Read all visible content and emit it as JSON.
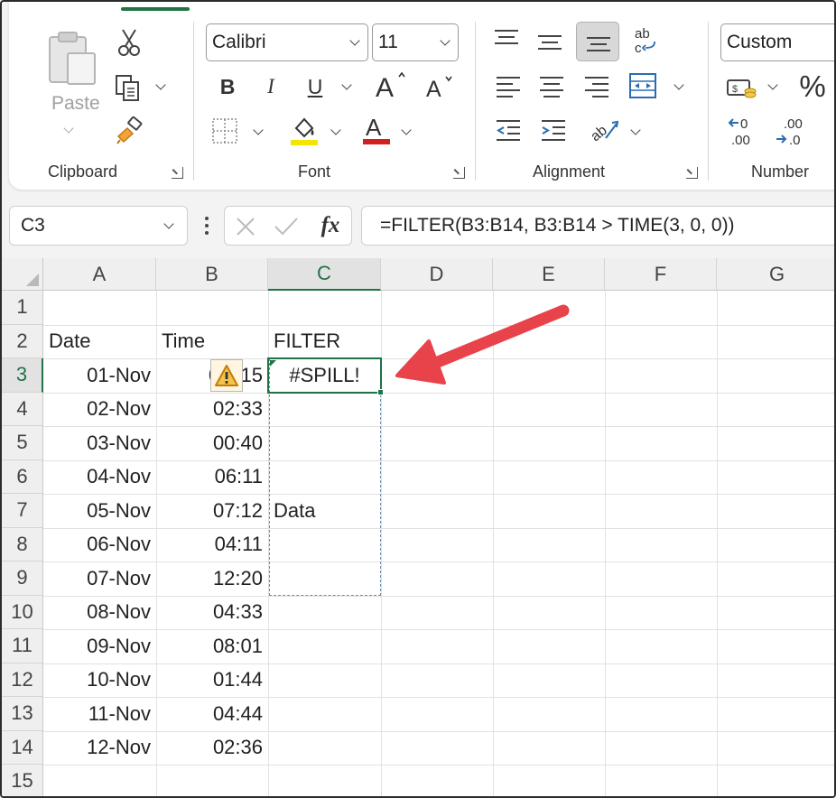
{
  "ribbon": {
    "clipboard": {
      "paste_label": "Paste",
      "group_label": "Clipboard"
    },
    "font": {
      "family": "Calibri",
      "size": "11",
      "bold": "B",
      "italic": "I",
      "underline": "U",
      "font_color_glyph": "A",
      "group_label": "Font"
    },
    "alignment": {
      "group_label": "Alignment",
      "wrap_glyph": "ab"
    },
    "number": {
      "format": "Custom",
      "percent": "%",
      "inc_decimal": ".0",
      "dec_decimal": ".00",
      "group_label": "Number"
    }
  },
  "formula_bar": {
    "name_box": "C3",
    "fx_label": "fx",
    "formula": "=FILTER(B3:B14, B3:B14 > TIME(3, 0, 0))"
  },
  "sheet": {
    "columns": [
      "A",
      "B",
      "C",
      "D",
      "E",
      "F",
      "G"
    ],
    "rows": [
      "1",
      "2",
      "3",
      "4",
      "5",
      "6",
      "7",
      "8",
      "9",
      "10",
      "11",
      "12",
      "13",
      "14",
      "15"
    ],
    "header_date": "Date",
    "header_time": "Time",
    "header_filter": "FILTER",
    "dates": [
      "01-Nov",
      "02-Nov",
      "03-Nov",
      "04-Nov",
      "05-Nov",
      "06-Nov",
      "07-Nov",
      "08-Nov",
      "09-Nov",
      "10-Nov",
      "11-Nov",
      "12-Nov"
    ],
    "times": [
      "15",
      "02:33",
      "00:40",
      "06:11",
      "07:12",
      "04:11",
      "12:20",
      "04:33",
      "08:01",
      "01:44",
      "04:44",
      "02:36"
    ],
    "time_first_partial": "0",
    "spill_error": "#SPILL!",
    "blocking_value": "Data"
  },
  "colors": {
    "accent": "#217346",
    "arrow": "#e8424a",
    "highlight_yellow": "#f5e400",
    "font_red": "#d02020",
    "spill_dash": "#6a8fb0"
  }
}
